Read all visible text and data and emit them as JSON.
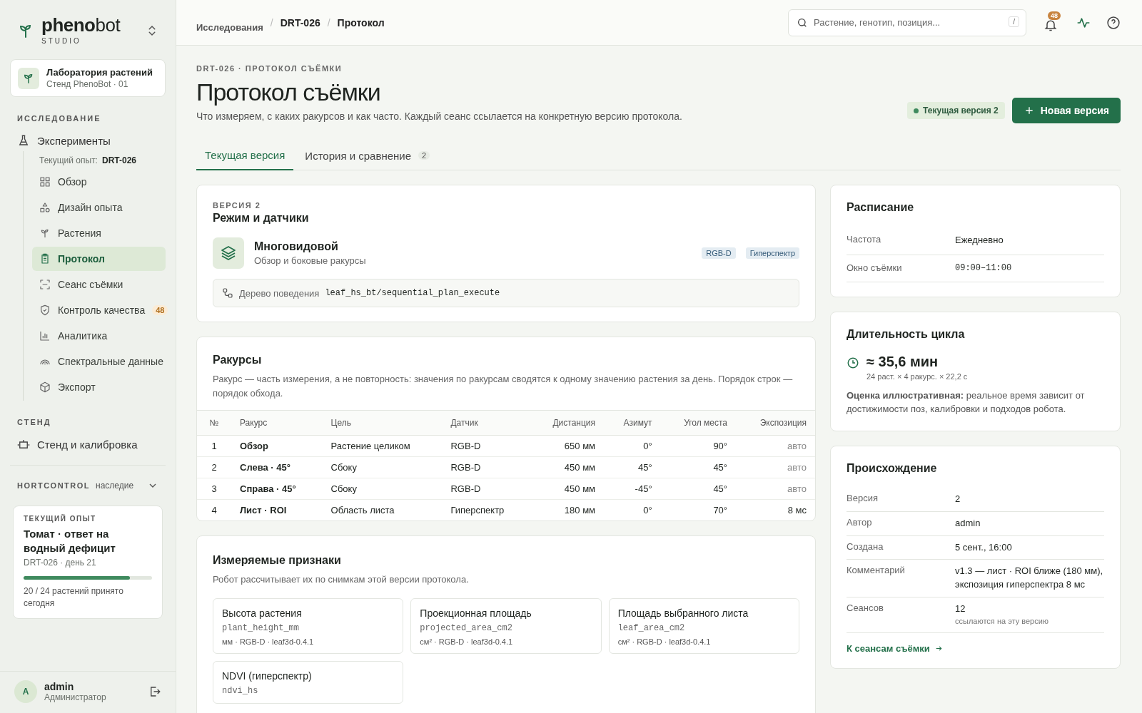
{
  "brand": {
    "name_bold": "pheno",
    "name_rest": "bot",
    "sub": "STUDIO"
  },
  "workspace": {
    "title": "Лаборатория растений",
    "subtitle": "Стенд PhenoBot · 01"
  },
  "sidebar": {
    "section_research": "ИССЛЕДОВАНИЕ",
    "experiments": "Эксперименты",
    "current_label": "Текущий опыт:",
    "current_id": "DRT-026",
    "items": [
      {
        "label": "Обзор",
        "selected": false
      },
      {
        "label": "Дизайн опыта",
        "selected": false
      },
      {
        "label": "Растения",
        "selected": false
      },
      {
        "label": "Протокол",
        "selected": true
      },
      {
        "label": "Сеанс съёмки",
        "selected": false
      },
      {
        "label": "Контроль качества",
        "selected": false,
        "badge": "48"
      },
      {
        "label": "Аналитика",
        "selected": false
      },
      {
        "label": "Спектральные данные",
        "selected": false
      },
      {
        "label": "Экспорт",
        "selected": false
      }
    ],
    "section_stand": "СТЕНД",
    "stand_item": "Стенд и калибровка",
    "legacy": {
      "label": "HORTCONTROL",
      "note": "наследие",
      "expanded": false
    },
    "current_card": {
      "eyebrow": "ТЕКУЩИЙ ОПЫТ",
      "title": "Томат · ответ на водный дефицит",
      "meta": "DRT-026 · день 21",
      "level": 0.83,
      "caption": "20 / 24 растений принято сегодня"
    },
    "user": {
      "initial": "A",
      "name": "admin",
      "role": "Администратор"
    }
  },
  "topbar": {
    "breadcrumbs": [
      {
        "text": "Исследования",
        "kind": "link"
      },
      {
        "text": "/",
        "kind": "separator"
      },
      {
        "text": "DRT-026",
        "kind": "link_strong"
      },
      {
        "text": "/",
        "kind": "separator"
      },
      {
        "text": "Протокол",
        "kind": "current"
      }
    ],
    "search": {
      "placeholder": "Растение, генотип, позиция...",
      "shortcut": "/"
    },
    "notifications_badge": "48"
  },
  "header": {
    "eyebrow": "DRT-026 · ПРОТОКОЛ СЪЁМКИ",
    "title": "Протокол съёмки",
    "description": "Что измеряем, с каких ракурсов и как часто. Каждый сеанс ссылается на конкретную версию протокола.",
    "status": "Текущая версия 2",
    "button": "Новая версия"
  },
  "tabs": [
    {
      "label": "Текущая версия",
      "selected": true
    },
    {
      "label": "История и сравнение",
      "count": "2",
      "selected": false
    }
  ],
  "mode_card": {
    "eyebrow": "ВЕРСИЯ 2",
    "title": "Режим и датчики",
    "mode_name": "Многовидовой",
    "mode_description": "Обзор и боковые ракурсы",
    "tags": [
      "RGB-D",
      "Гиперспектр"
    ],
    "tree_label": "Дерево поведения",
    "tree_value": "leaf_hs_bt/sequential_plan_execute"
  },
  "views_card": {
    "title": "Ракурсы",
    "description": "Ракурс — часть измерения, а не повторность: значения по ракурсам сводятся к одному значению растения за день. Порядок строк — порядок обхода.",
    "columns": [
      "№",
      "Ракурс",
      "Цель",
      "Датчик",
      "Дистанция",
      "Азимут",
      "Угол места",
      "Экспозиция"
    ],
    "rows": [
      {
        "cells": [
          "1",
          "Обзор",
          "Растение целиком",
          "RGB-D",
          "650 мм",
          "0°",
          "90°",
          "авто"
        ],
        "exposure_muted": true
      },
      {
        "cells": [
          "2",
          "Слева · 45°",
          "Сбоку",
          "RGB-D",
          "450 мм",
          "45°",
          "45°",
          "авто"
        ],
        "exposure_muted": true
      },
      {
        "cells": [
          "3",
          "Справа · 45°",
          "Сбоку",
          "RGB-D",
          "450 мм",
          "-45°",
          "45°",
          "авто"
        ],
        "exposure_muted": true
      },
      {
        "cells": [
          "4",
          "Лист · ROI",
          "Область листа",
          "Гиперспектр",
          "180 мм",
          "0°",
          "70°",
          "8 мс"
        ],
        "exposure_muted": false
      }
    ]
  },
  "traits_card": {
    "title": "Измеряемые признаки",
    "description": "Робот рассчитывает их по снимкам этой версии протокола.",
    "items": [
      {
        "name": "Высота растения",
        "code": "plant_height_mm",
        "meta": "мм · RGB-D · leaf3d-0.4.1"
      },
      {
        "name": "Проекционная площадь",
        "code": "projected_area_cm2",
        "meta": "см² · RGB-D · leaf3d-0.4.1"
      },
      {
        "name": "Площадь выбранного листа",
        "code": "leaf_area_cm2",
        "meta": "см² · RGB-D · leaf3d-0.4.1"
      },
      {
        "name": "NDVI (гиперспектр)",
        "code": "ndvi_hs"
      }
    ]
  },
  "schedule_card": {
    "title": "Расписание",
    "rows": [
      {
        "label": "Частота",
        "value": "Ежедневно",
        "kind": "text"
      },
      {
        "label": "Окно съёмки",
        "value": "09:00–11:00",
        "kind": "mono"
      }
    ]
  },
  "cycle_card": {
    "title": "Длительность цикла",
    "value": "≈ 35,6 мин",
    "formula": "24 раст. × 4 ракурс. × 22,2 с",
    "note": "**Оценка иллюстративная:** реальное время зависит от достижимости поз, калибровки и подходов робота."
  },
  "origin_card": {
    "title": "Происхождение",
    "rows": [
      {
        "label": "Версия",
        "value": "2"
      },
      {
        "label": "Автор",
        "value": "admin"
      },
      {
        "label": "Создана",
        "value": "5 сент., 16:00"
      },
      {
        "label": "Комментарий",
        "value": "v1.3 — лист · ROI ближе (180 мм), экспозиция гиперспектра 8 мс"
      },
      {
        "label": "Сеансов",
        "value": "12",
        "sub": "ссылаются на эту версию"
      }
    ],
    "link": "К сеансам съёмки"
  }
}
